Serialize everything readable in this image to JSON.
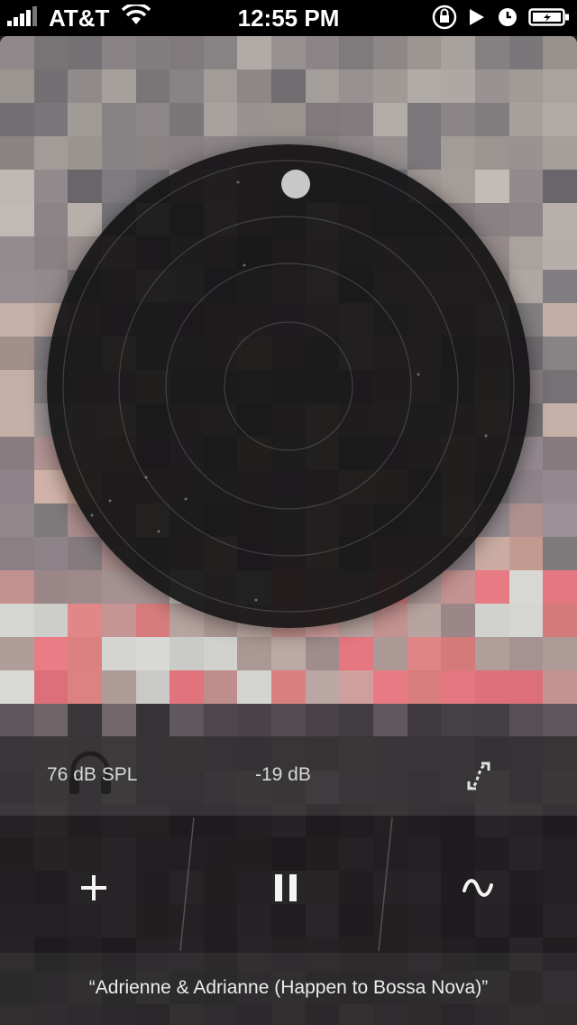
{
  "status_bar": {
    "carrier": "AT&T",
    "time": "12:55 PM",
    "icons": [
      "signal-bars-icon",
      "wifi-icon",
      "rotation-lock-icon",
      "play-icon",
      "alarm-icon",
      "battery-icon"
    ]
  },
  "level_bar": {
    "spl": "76 dB SPL",
    "gain": "-19 dB",
    "icons": [
      "headphone-icon",
      "curve-icon"
    ]
  },
  "controls": {
    "icons": [
      "plus-icon",
      "pause-icon",
      "sine-wave-icon"
    ]
  },
  "now_playing": {
    "title": "“Adrienne & Adrianne (Happen to Bossa Nova)”"
  },
  "colors": {
    "disc": "#141213",
    "controls_bg": "#181618",
    "text": "#ececec"
  }
}
